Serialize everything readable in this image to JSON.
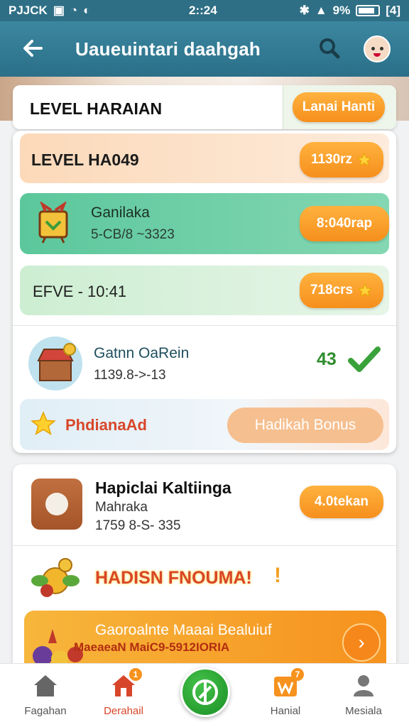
{
  "status_bar": {
    "carrier": "PJJCK",
    "time": "2::24",
    "battery": "9%",
    "extra": "[4]"
  },
  "app_bar": {
    "title": "Uaueuintari daahgah"
  },
  "level_header": {
    "title": "LEVEL HARAIAN",
    "button": "Lanai Hanti"
  },
  "rows": {
    "level": {
      "label": "LEVEL HA049",
      "pill": "1130rz"
    },
    "game": {
      "name": "Ganilaka",
      "sub": "5-CB/8 ~3323",
      "pill": "8:040rap"
    },
    "time": {
      "label": "EFVE - 10:41",
      "pill": "718crs"
    },
    "reward": {
      "name": "Gatnn OaRein",
      "sub": "1139.8->-13",
      "count": "43"
    },
    "bonus": {
      "label": "PhdianaAd",
      "button": "Hadikah Bonus"
    }
  },
  "card2": {
    "title": "Hapiclai Kaltiinga",
    "line1": "Mahraka",
    "line2": "1759 8-S- 335",
    "pill": "4.0tekan",
    "promo": "HADISN FNOUMA!",
    "promo_excl": "!",
    "banner_title": "Gaoroalnte Maaai Bealuiuf",
    "banner_sub": "MaeaeaN MaiC9-5912IORIA"
  },
  "bottom_nav": [
    {
      "label": "Fagahan"
    },
    {
      "label": "Derahail",
      "badge": "1"
    },
    {
      "label": ""
    },
    {
      "label": "Hanial",
      "badge": "7"
    },
    {
      "label": "Mesiala"
    }
  ],
  "colors": {
    "primary": "#2f6f86",
    "accent": "#f6921e",
    "green": "#5cc79c",
    "danger": "#d8462a"
  }
}
